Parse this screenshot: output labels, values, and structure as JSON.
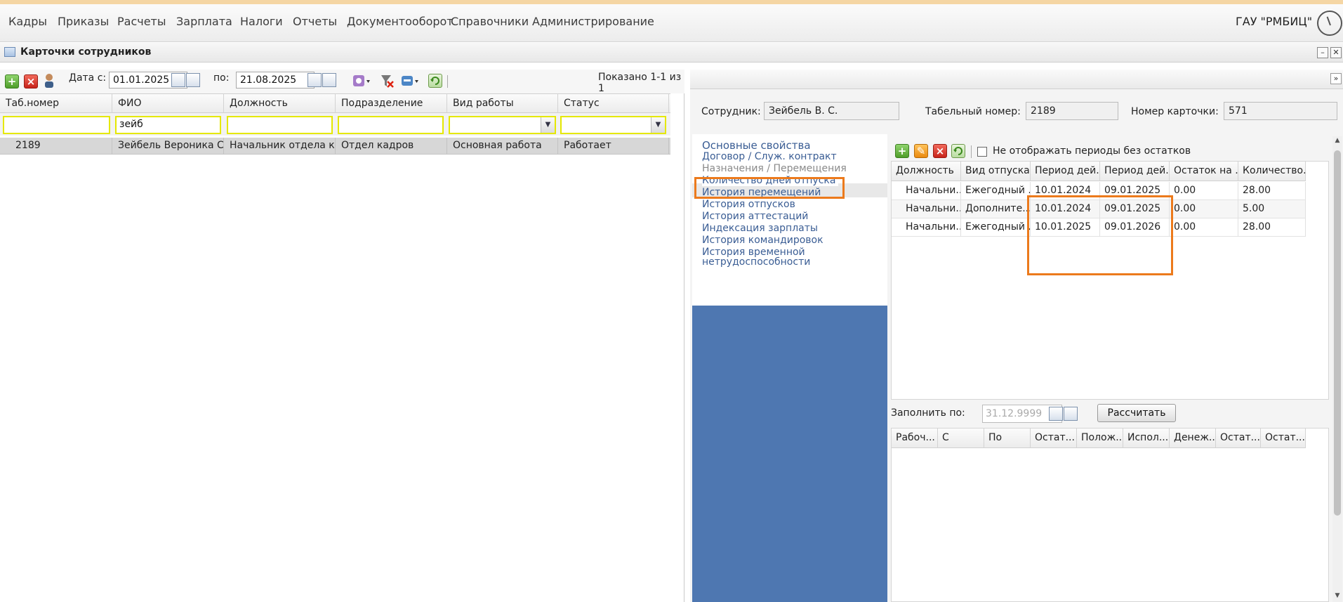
{
  "menu": {
    "items": [
      "Кадры",
      "Приказы",
      "Расчеты",
      "Зарплата",
      "Налоги",
      "Отчеты",
      "Документооборот",
      "Справочники",
      "Администрирование"
    ],
    "org": "ГАУ \"РМБИЦ\""
  },
  "window": {
    "title": "Карточки сотрудников",
    "minimize": "–",
    "close": "✕"
  },
  "left": {
    "date_from_label": "Дата с:",
    "date_from": "01.01.2025",
    "date_to_label": "по:",
    "date_to": "21.08.2025",
    "shown": "Показано 1-1 из 1",
    "columns": [
      "Таб.номер",
      "ФИО",
      "Должность",
      "Подразделение",
      "Вид работы",
      "Статус"
    ],
    "filters": {
      "fio": "зейб"
    },
    "row": [
      "2189",
      "Зейбель Вероника С...",
      "Начальник отдела ка...",
      "Отдел кадров",
      "Основная работа",
      "Работает"
    ]
  },
  "right": {
    "expand": "»",
    "employee_label": "Сотрудник:",
    "employee": "Зейбель В. С.",
    "tab_label": "Табельный номер:",
    "tab_number": "2189",
    "card_label": "Номер карточки:",
    "card_number": "571",
    "nav": [
      "Основные свойства",
      "Договор / Служ. контракт",
      "Назначения / Перемещения",
      "Количество дней отпуска",
      "История перемещений",
      "История отпусков",
      "История аттестаций",
      "Индексация зарплаты",
      "История командировок",
      "История временной",
      "нетрудоспособности"
    ],
    "hide_label": "Не отображать периоды без остатков",
    "grid_columns": [
      "Должность",
      "Вид отпуска",
      "Период дей...",
      "Период дей...",
      "Остаток на ...",
      "Количество..."
    ],
    "grid_rows": [
      [
        "Начальни...",
        "Ежегодный ...",
        "10.01.2024",
        "09.01.2025",
        "0.00",
        "28.00"
      ],
      [
        "Начальни...",
        "Дополните...",
        "10.01.2024",
        "09.01.2025",
        "0.00",
        "5.00"
      ],
      [
        "Начальни...",
        "Ежегодный ...",
        "10.01.2025",
        "09.01.2026",
        "0.00",
        "28.00"
      ]
    ],
    "fill_label": "Заполнить по:",
    "fill_placeholder": "31.12.9999",
    "calc_button": "Рассчитать",
    "grid2_columns": [
      "Рабоч...",
      "С",
      "По",
      "Остат...",
      "Полож...",
      "Испол...",
      "Денеж...",
      "Остат...",
      "Остат..."
    ]
  },
  "colors": {
    "accent": "#ec7a1c",
    "nav_blue": "#4e77b1",
    "link": "#3a5d94"
  }
}
